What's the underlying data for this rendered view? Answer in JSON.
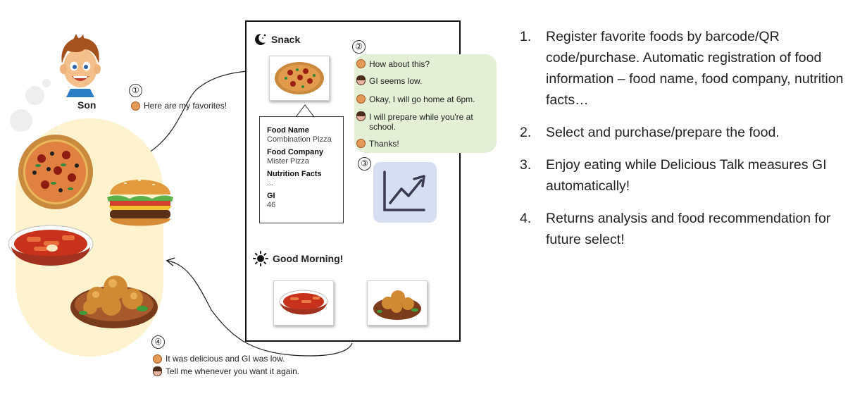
{
  "person": {
    "label": "Son"
  },
  "callouts": {
    "n1": "①",
    "n2": "②",
    "n3": "③",
    "n4": "④"
  },
  "favorites_message": "Here are my favorites!",
  "phone": {
    "snack_title": "Snack",
    "morning_title": "Good Morning!",
    "info_card": {
      "food_name_label": "Food Name",
      "food_name_value": "Combination Pizza",
      "food_company_label": "Food Company",
      "food_company_value": "Mister Pizza",
      "nutrition_label": "Nutrition Facts",
      "nutrition_value": "...",
      "gi_label": "GI",
      "gi_value": "46"
    },
    "chat": [
      {
        "speaker": "son",
        "text": "How about this?"
      },
      {
        "speaker": "mom",
        "text": "GI seems low."
      },
      {
        "speaker": "son",
        "text": "Okay, I will go home at 6pm."
      },
      {
        "speaker": "mom",
        "text": "I will prepare while you're at school."
      },
      {
        "speaker": "son",
        "text": "Thanks!"
      }
    ]
  },
  "feedback": [
    {
      "speaker": "son",
      "text": "It was delicious and GI was low."
    },
    {
      "speaker": "mom",
      "text": "Tell me whenever you want it again."
    }
  ],
  "steps": [
    {
      "num": "1.",
      "text": "Register favorite foods by barcode/QR code/purchase. Automatic registration of food information – food name, food company, nutrition facts…"
    },
    {
      "num": "2.",
      "text": "Select and purchase/prepare the food."
    },
    {
      "num": "3.",
      "text": "Enjoy eating while Delicious Talk measures GI automatically!"
    },
    {
      "num": "4.",
      "text": "Returns analysis and food recommendation for future select!"
    }
  ],
  "colors": {
    "chat_bubble": "#e3f0d6",
    "chart_tile": "#d6dff2",
    "favorites_blob": "#fff3cf"
  },
  "icons": [
    "moon-icon",
    "sun-icon",
    "growth-chart-icon",
    "son-avatar-icon",
    "mom-avatar-icon"
  ]
}
